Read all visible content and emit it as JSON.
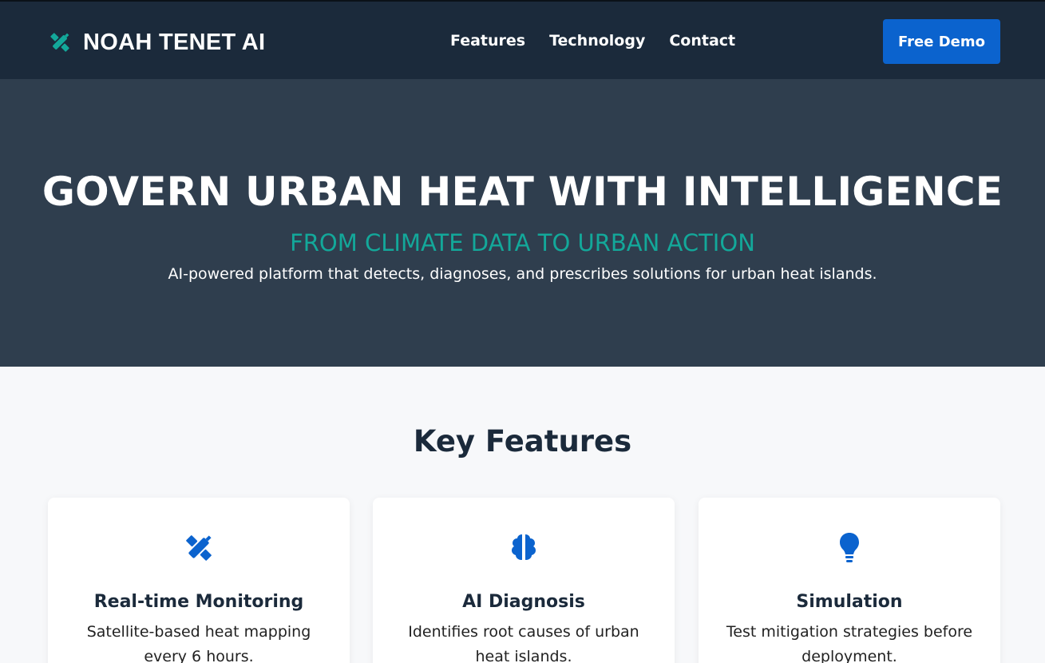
{
  "brand": {
    "name": "NOAH TENET AI",
    "icon": "satellite-icon",
    "icon_color": "#13a89a"
  },
  "nav": {
    "links": [
      "Features",
      "Technology",
      "Contact"
    ],
    "cta_label": "Free Demo"
  },
  "hero": {
    "title": "GOVERN URBAN HEAT WITH INTELLIGENCE",
    "subtitle": "FROM CLIMATE DATA TO URBAN ACTION",
    "description": "AI-powered platform that detects, diagnoses, and prescribes solutions for urban heat islands."
  },
  "features": {
    "title": "Key Features",
    "cards": [
      {
        "icon": "satellite-icon",
        "title": "Real-time Monitoring",
        "description": "Satellite-based heat mapping every 6 hours."
      },
      {
        "icon": "brain-icon",
        "title": "AI Diagnosis",
        "description": "Identifies root causes of urban heat islands."
      },
      {
        "icon": "lightbulb-icon",
        "title": "Simulation",
        "description": "Test mitigation strategies before deployment."
      }
    ]
  },
  "colors": {
    "nav_bg": "#1b2a3b",
    "hero_bg": "#2f3e4e",
    "accent": "#13a89a",
    "primary": "#0b63ce",
    "section_bg": "#f7f8fa"
  }
}
